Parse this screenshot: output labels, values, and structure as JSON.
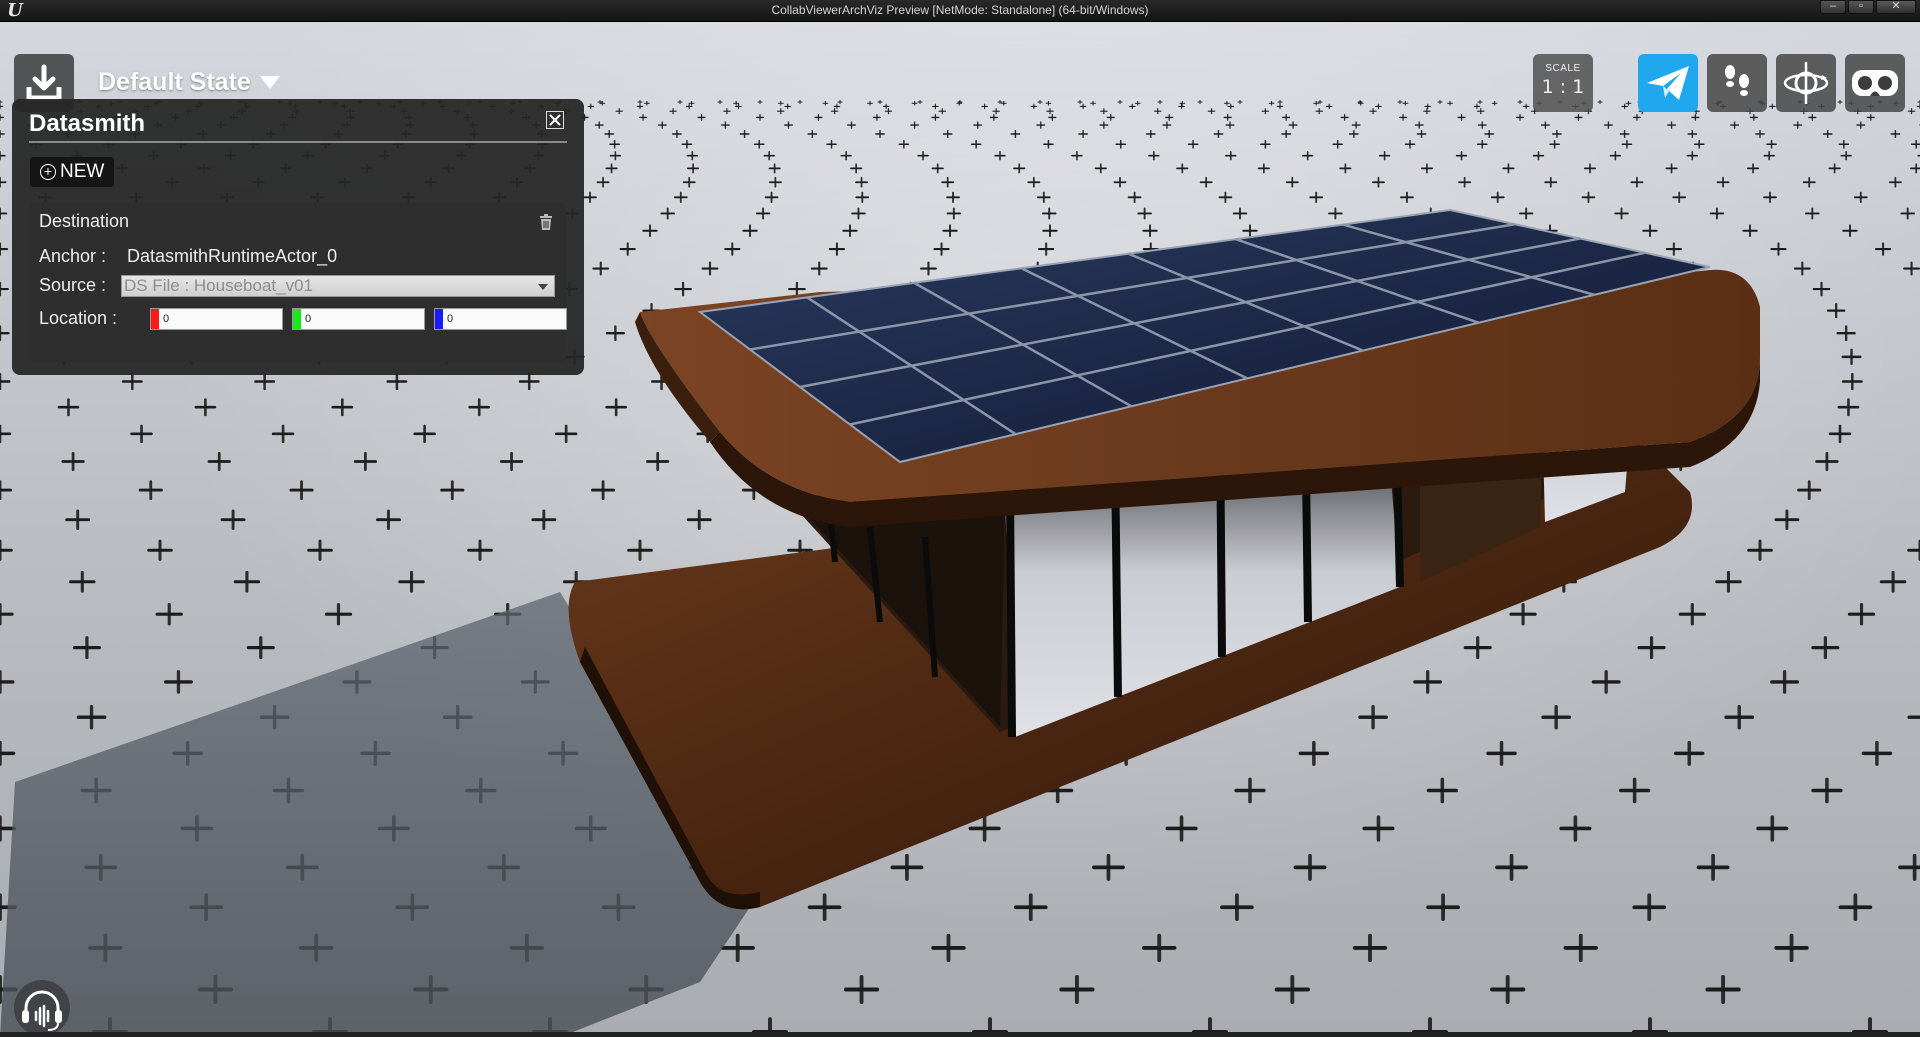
{
  "window": {
    "title": "CollabViewerArchViz Preview [NetMode: Standalone]  (64-bit/Windows)",
    "logo": "U",
    "minimize": "–",
    "maximize": "▫",
    "close": "✕"
  },
  "toolbar": {
    "save_icon": "download-tray-icon",
    "state_label": "Default State",
    "scale_caption": "SCALE",
    "scale_value": "1 : 1",
    "tools": [
      {
        "icon": "paper-plane-icon",
        "active": true
      },
      {
        "icon": "footsteps-icon",
        "active": false
      },
      {
        "icon": "orbit-icon",
        "active": false
      },
      {
        "icon": "vr-headset-icon",
        "active": false
      }
    ],
    "active_color": "#1fa8ee"
  },
  "datasmith_panel": {
    "title": "Datasmith",
    "new_button": "NEW",
    "destination": {
      "title": "Destination",
      "anchor_label": "Anchor :",
      "anchor_value": "DatasmithRuntimeActor_0",
      "source_label": "Source :",
      "source_value": "DS File : Houseboat_v01",
      "location_label": "Location :",
      "location": {
        "x": "0",
        "y": "0",
        "z": "0"
      },
      "axis_colors": {
        "x": "#ff1a1a",
        "y": "#1ee61e",
        "z": "#1a1aff"
      }
    }
  },
  "voice": {
    "icon": "headset-voice-icon"
  }
}
